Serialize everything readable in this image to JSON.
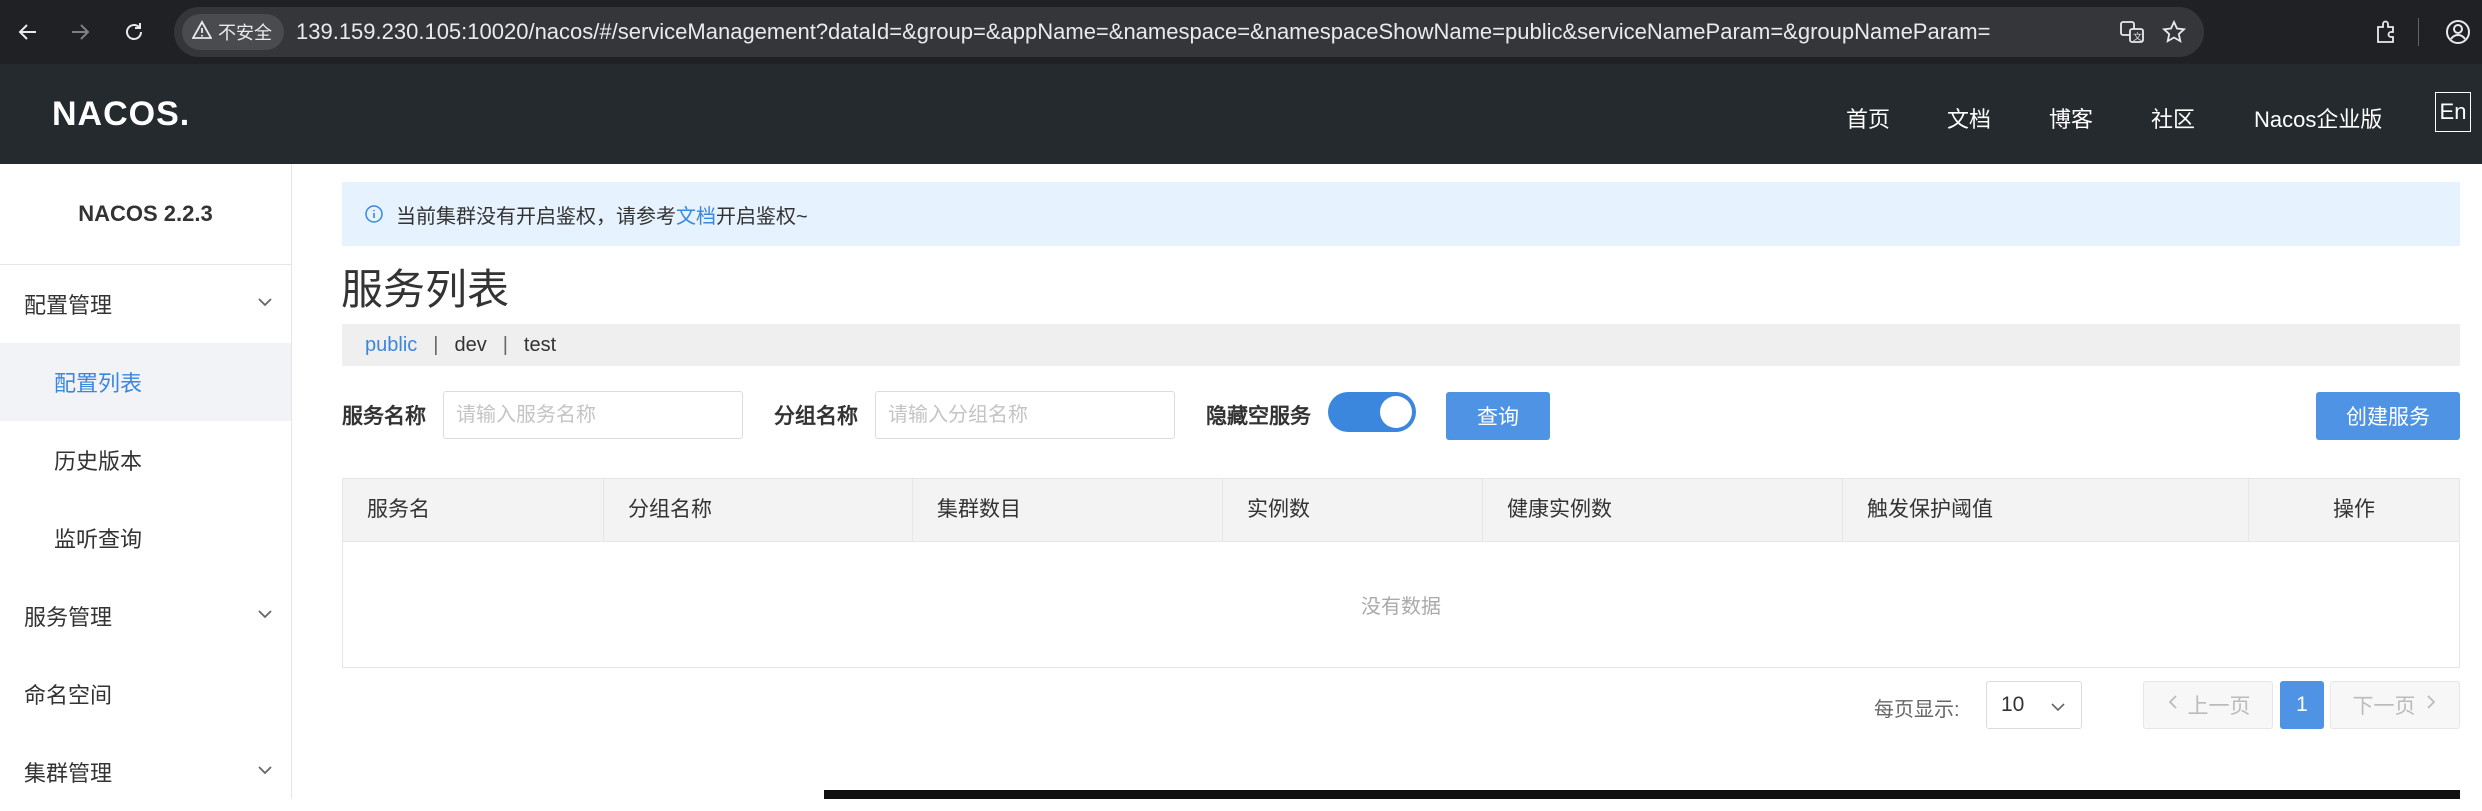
{
  "browser": {
    "security_label": "不安全",
    "url": "139.159.230.105:10020/nacos/#/serviceManagement?dataId=&group=&appName=&namespace=&namespaceShowName=public&serviceNameParam=&groupNameParam="
  },
  "header": {
    "logo": "NACOS.",
    "nav": [
      "首页",
      "文档",
      "博客",
      "社区",
      "Nacos企业版"
    ],
    "lang": "En"
  },
  "sidebar": {
    "version": "NACOS 2.2.3",
    "items": [
      {
        "label": "配置管理"
      },
      {
        "label": "配置列表"
      },
      {
        "label": "历史版本"
      },
      {
        "label": "监听查询"
      },
      {
        "label": "服务管理"
      },
      {
        "label": "命名空间"
      },
      {
        "label": "集群管理"
      }
    ]
  },
  "notice": {
    "prefix": "当前集群没有开启鉴权，请参考",
    "link": "文档",
    "suffix": "开启鉴权~"
  },
  "page": {
    "title": "服务列表"
  },
  "namespaces": [
    {
      "label": "public",
      "active": true
    },
    {
      "label": "dev",
      "active": false
    },
    {
      "label": "test",
      "active": false
    }
  ],
  "filters": {
    "service_name_label": "服务名称",
    "service_name_placeholder": "请输入服务名称",
    "group_name_label": "分组名称",
    "group_name_placeholder": "请输入分组名称",
    "hide_empty_label": "隐藏空服务",
    "hide_empty_on": true,
    "query_button": "查询",
    "create_button": "创建服务"
  },
  "table": {
    "columns": [
      "服务名",
      "分组名称",
      "集群数目",
      "实例数",
      "健康实例数",
      "触发保护阈值",
      "操作"
    ],
    "empty_text": "没有数据"
  },
  "pagination": {
    "page_size_label": "每页显示:",
    "page_size": "10",
    "prev": "上一页",
    "current": "1",
    "next": "下一页"
  },
  "colors": {
    "accent": "#3a87dd",
    "header_bg": "#252a2f",
    "notice_bg": "#e6f2fd"
  }
}
